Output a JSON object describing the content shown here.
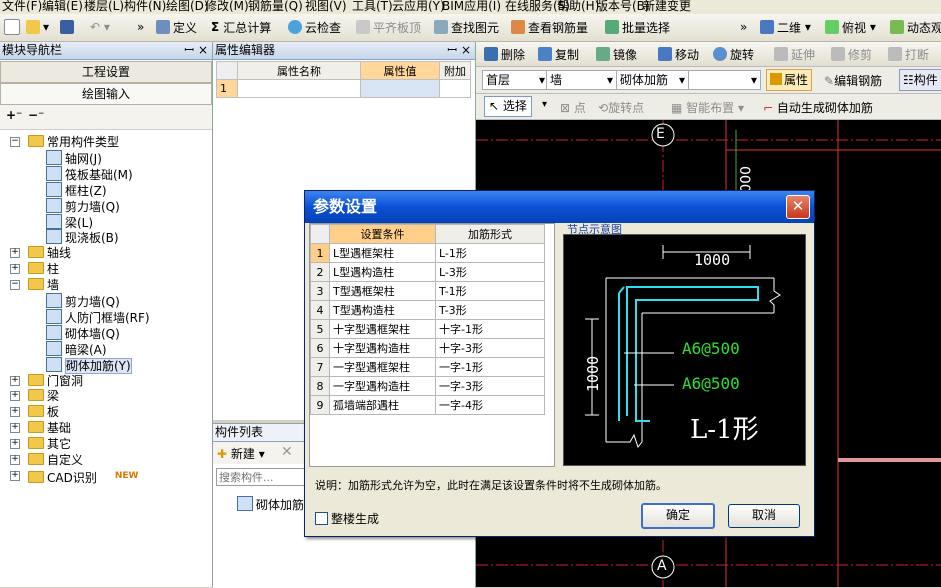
{
  "menubar": [
    "文件(F)",
    "编辑(E)",
    "楼层(L)",
    "构件(N)",
    "绘图(D)",
    "修改(M)",
    "钢筋量(Q)",
    "视图(V)",
    "工具(T)",
    "云应用(Y)",
    "BIM应用(I)",
    "在线服务(S)",
    "帮助(H)",
    "版本号(B)",
    "新建变更"
  ],
  "toolbar1": {
    "define": "定义",
    "sum": "汇总计算",
    "cloud_check": "云检查",
    "flat_top": "平齐板顶",
    "find": "查找图元",
    "view_rebar": "查看钢筋量",
    "batch_select": "批量选择",
    "view_2d": "二维",
    "view_top": "俯视",
    "dynamic": "动态观察"
  },
  "left_panel": {
    "title": "模块导航栏",
    "project_settings": "工程设置",
    "drawing_input": "绘图输入",
    "tree": [
      {
        "label": "常用构件类型",
        "level": 0,
        "type": "folder",
        "expanded": true
      },
      {
        "label": "轴网(J)",
        "level": 1,
        "type": "item"
      },
      {
        "label": "筏板基础(M)",
        "level": 1,
        "type": "item"
      },
      {
        "label": "框柱(Z)",
        "level": 1,
        "type": "item"
      },
      {
        "label": "剪力墙(Q)",
        "level": 1,
        "type": "item"
      },
      {
        "label": "梁(L)",
        "level": 1,
        "type": "item"
      },
      {
        "label": "现浇板(B)",
        "level": 1,
        "type": "item"
      },
      {
        "label": "轴线",
        "level": 0,
        "type": "folder",
        "expanded": false
      },
      {
        "label": "柱",
        "level": 0,
        "type": "folder",
        "expanded": false
      },
      {
        "label": "墙",
        "level": 0,
        "type": "folder",
        "expanded": true
      },
      {
        "label": "剪力墙(Q)",
        "level": 1,
        "type": "item"
      },
      {
        "label": "人防门框墙(RF)",
        "level": 1,
        "type": "item"
      },
      {
        "label": "砌体墙(Q)",
        "level": 1,
        "type": "item"
      },
      {
        "label": "暗梁(A)",
        "level": 1,
        "type": "item"
      },
      {
        "label": "砌体加筋(Y)",
        "level": 1,
        "type": "item",
        "selected": true
      },
      {
        "label": "门窗洞",
        "level": 0,
        "type": "folder",
        "expanded": false
      },
      {
        "label": "梁",
        "level": 0,
        "type": "folder",
        "expanded": false
      },
      {
        "label": "板",
        "level": 0,
        "type": "folder",
        "expanded": false
      },
      {
        "label": "基础",
        "level": 0,
        "type": "folder",
        "expanded": false
      },
      {
        "label": "其它",
        "level": 0,
        "type": "folder",
        "expanded": false
      },
      {
        "label": "自定义",
        "level": 0,
        "type": "folder",
        "expanded": false
      },
      {
        "label": "CAD识别",
        "level": 0,
        "type": "folder",
        "expanded": false,
        "badge": "NEW"
      }
    ]
  },
  "property_editor": {
    "title": "属性编辑器",
    "col_name": "属性名称",
    "col_value": "属性值",
    "col_extra": "附加",
    "row1": "1"
  },
  "component_list": {
    "title": "构件列表",
    "new_button": "新建",
    "search_placeholder": "搜索构件...",
    "item": "砌体加筋"
  },
  "edit_toolbar": {
    "delete": "删除",
    "copy": "复制",
    "mirror": "镜像",
    "move": "移动",
    "rotate": "旋转",
    "extend": "延伸",
    "trim": "修剪",
    "break": "打断"
  },
  "layer_bar": {
    "floor": "首层",
    "category": "墙",
    "type": "砌体加筋",
    "instance": "",
    "properties": "属性",
    "edit_rebar": "编辑钢筋",
    "components": "构件"
  },
  "draw_bar": {
    "select": "选择",
    "point": "点",
    "rotate_point": "旋转点",
    "smart_layout": "智能布置",
    "auto_generate": "自动生成砌体加筋"
  },
  "canvas": {
    "axis_top": "E",
    "axis_bottom": "A",
    "dim_vertical": "000"
  },
  "dialog": {
    "title": "参数设置",
    "col_condition": "设置条件",
    "col_form": "加筋形式",
    "rows": [
      {
        "no": "1",
        "condition": "L型遇框架柱",
        "form": "L-1形"
      },
      {
        "no": "2",
        "condition": "L型遇构造柱",
        "form": "L-3形"
      },
      {
        "no": "3",
        "condition": "T型遇框架柱",
        "form": "T-1形"
      },
      {
        "no": "4",
        "condition": "T型遇构造柱",
        "form": "T-3形"
      },
      {
        "no": "5",
        "condition": "十字型遇框架柱",
        "form": "十字-1形"
      },
      {
        "no": "6",
        "condition": "十字型遇构造柱",
        "form": "十字-3形"
      },
      {
        "no": "7",
        "condition": "一字型遇框架柱",
        "form": "一字-1形"
      },
      {
        "no": "8",
        "condition": "一字型遇构造柱",
        "form": "一字-3形"
      },
      {
        "no": "9",
        "condition": "孤墙端部遇柱",
        "form": "一字-4形"
      }
    ],
    "diagram_label": "节点示意图",
    "diagram": {
      "dim_h": "1000",
      "dim_v": "1000",
      "rebar1": "A6@500",
      "rebar2": "A6@500",
      "form_name": "L-1形"
    },
    "note": "说明：加筋形式允许为空，此时在满足该设置条件时将不生成砌体加筋。",
    "whole_floor": "整楼生成",
    "ok": "确定",
    "cancel": "取消"
  }
}
